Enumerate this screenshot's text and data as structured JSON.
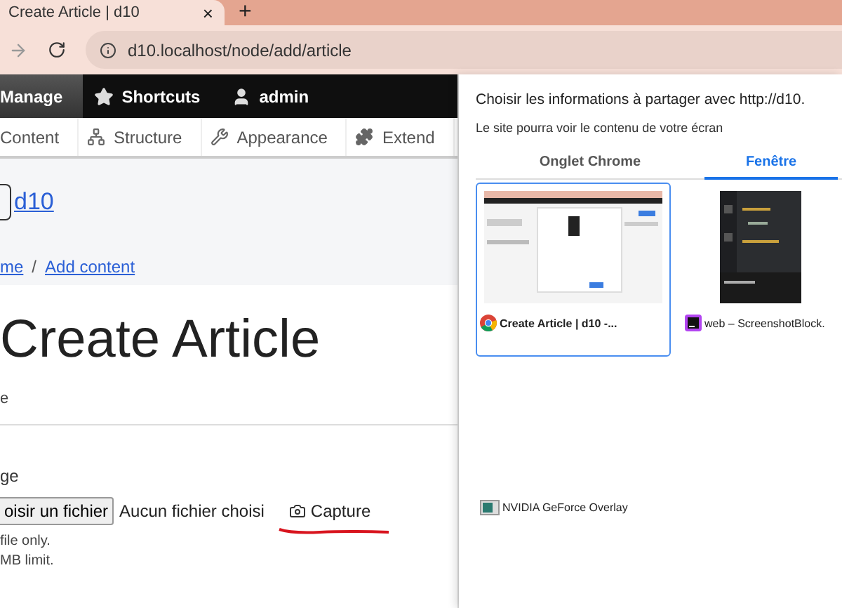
{
  "browser": {
    "tab_title": "Create Article | d10",
    "tab_close": "×",
    "new_tab": "+",
    "url": "d10.localhost/node/add/article"
  },
  "toolbar": [
    {
      "label": "Manage",
      "kind": "manage",
      "selected": true
    },
    {
      "label": "Shortcuts",
      "kind": "shortcuts",
      "selected": false
    },
    {
      "label": "admin",
      "kind": "user",
      "selected": false
    }
  ],
  "admin_menu": [
    {
      "label": "Content",
      "kind": "content"
    },
    {
      "label": "Structure",
      "kind": "structure"
    },
    {
      "label": "Appearance",
      "kind": "appearance"
    },
    {
      "label": "Extend",
      "kind": "extend"
    }
  ],
  "page": {
    "site_name": "d10",
    "breadcrumb": [
      "me",
      "Add content"
    ],
    "breadcrumb_separator": "/",
    "title": "Create Article",
    "subtitle": "e",
    "field_label": "ge",
    "file_button": "oisir un fichier",
    "file_status": "Aucun fichier choisi",
    "capture": "Capture",
    "descriptions": [
      "file only.",
      "MB limit."
    ]
  },
  "dialog": {
    "title": "Choisir les informations à partager avec http://d10.",
    "subtitle": "Le site pourra voir le contenu de votre écran",
    "tabs": [
      {
        "label": "Onglet Chrome",
        "selected": false
      },
      {
        "label": "Fenêtre",
        "selected": true
      }
    ],
    "sources": [
      {
        "label": "Create Article | d10 -...",
        "kind": "chrome",
        "selected": true
      },
      {
        "label": "web – ScreenshotBlock.",
        "kind": "phpstorm",
        "selected": false
      },
      {
        "label": "NVIDIA GeForce Overlay",
        "kind": "nvidia",
        "selected": false
      }
    ]
  }
}
